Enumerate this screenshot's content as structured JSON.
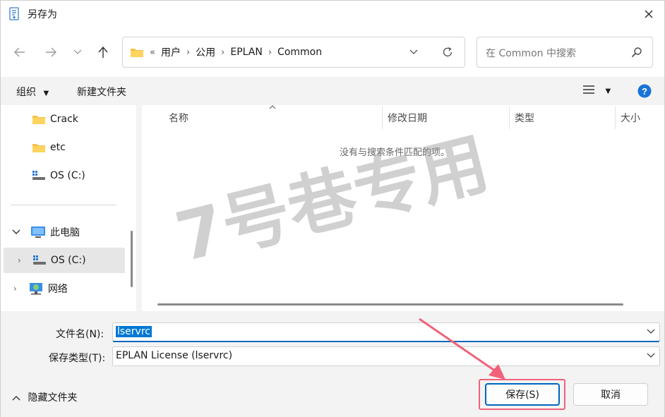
{
  "window": {
    "title": "另存为"
  },
  "address": {
    "crumbs": [
      "用户",
      "公用",
      "EPLAN",
      "Common"
    ],
    "overflow": "«"
  },
  "search": {
    "placeholder": "在 Common 中搜索"
  },
  "command_bar": {
    "organize": "组织",
    "new_folder": "新建文件夹"
  },
  "nav_pane": {
    "items": [
      {
        "label": "Crack",
        "icon": "folder-icon"
      },
      {
        "label": "etc",
        "icon": "folder-icon"
      },
      {
        "label": "OS (C:)",
        "icon": "drive-icon"
      },
      {
        "label": "此电脑",
        "icon": "computer-icon"
      },
      {
        "label": "OS (C:)",
        "icon": "drive-icon"
      },
      {
        "label": "网络",
        "icon": "network-icon"
      }
    ]
  },
  "columns": [
    "名称",
    "修改日期",
    "类型",
    "大小"
  ],
  "empty_message": "没有与搜索条件匹配的项。",
  "form": {
    "filename_label": "文件名(N):",
    "filename_value": "lservrc",
    "filetype_label": "保存类型(T):",
    "filetype_value": "EPLAN License (lservrc)"
  },
  "footer": {
    "hide_folders": "隐藏文件夹",
    "save": "保存(S)",
    "cancel": "取消"
  },
  "watermark": "7号巷专用",
  "colors": {
    "accent": "#0067c0",
    "annotation": "#f0627a",
    "selection": "#0078d4"
  }
}
